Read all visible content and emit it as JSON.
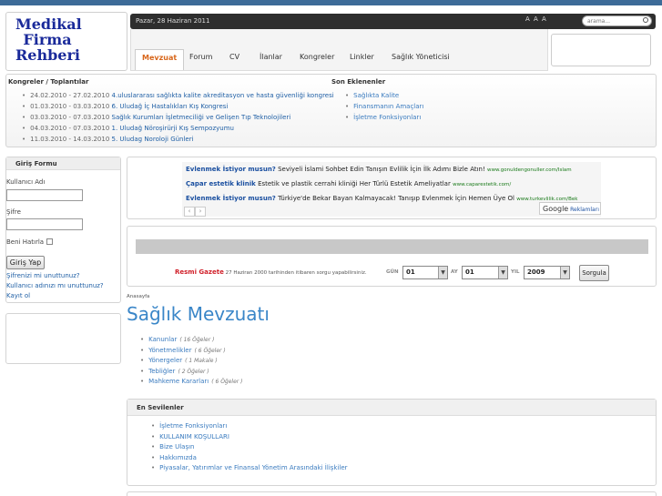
{
  "logo": {
    "line1": "Medikal",
    "line2": "Firma",
    "line3": "Rehberi"
  },
  "header": {
    "date": "Pazar, 28 Haziran 2011",
    "font_sizer": "A A A",
    "search_placeholder": "arama..."
  },
  "nav": {
    "items": [
      "Mevzuat",
      "Forum",
      "CV",
      "İlanlar",
      "Kongreler",
      "Linkler",
      "Sağlık Yöneticisi"
    ],
    "active": "Mevzuat"
  },
  "kongreler": {
    "title": "Kongreler / Toplantılar",
    "items": [
      {
        "dates": "24.02.2010 - 27.02.2010",
        "title": "4.uluslararası sağlıkta kalite akreditasyon ve hasta güvenliği kongresi"
      },
      {
        "dates": "01.03.2010 - 03.03.2010",
        "title": "6. Uludağ İç Hastalıkları Kış Kongresi"
      },
      {
        "dates": "03.03.2010 - 07.03.2010",
        "title": "Sağlık Kurumları İşletmeciliği ve Gelişen Tıp Teknolojileri"
      },
      {
        "dates": "04.03.2010 - 07.03.2010",
        "title": "1. Uludağ Nöroşirürji Kış Sempozyumu"
      },
      {
        "dates": "11.03.2010 - 14.03.2010",
        "title": "5. Uludag Noroloji Günleri"
      }
    ]
  },
  "son_eklenenler": {
    "title": "Son Eklenenler",
    "items": [
      "Sağlıkta Kalite",
      "Finansmanın Amaçları",
      "İşletme Fonksiyonları"
    ]
  },
  "login": {
    "title": "Giriş Formu",
    "username_label": "Kullanıcı Adı",
    "password_label": "Şifre",
    "remember_label": "Beni Hatırla",
    "button": "Giriş Yap",
    "forgot_password": "Şifrenizi mi unuttunuz?",
    "forgot_username": "Kullanıcı adınızı mı unuttunuz?",
    "register": "Kayıt ol"
  },
  "ads": {
    "rows": [
      {
        "title": "Evlenmek İstiyor musun?",
        "text": "Seviyeli İslami Sohbet Edin Tanışın Evlilik İçin İlk Adımı Bizle Atın!",
        "url": "www.gonuldengonuller.com/Islam"
      },
      {
        "title": "Çapar estetik klinik",
        "text": "Estetik ve plastik cerrahi kliniği Her Türlü Estetik Ameliyatlar",
        "url": "www.caparestetik.com/"
      },
      {
        "title": "Evlenmek İstiyor musun?",
        "text": "Türkiye'de Bekar Bayan Kalmayacak! Tanışıp Evlenmek İçin Hemen Üye Ol",
        "url": "www.turkevlilik.com/Bek"
      }
    ],
    "prev": "‹",
    "next": "›",
    "google_label": "Google",
    "reklam_label": "Reklamları"
  },
  "resmi_gazete": {
    "brand": "Resmi Gazete",
    "text": "27 Haziran 2000 tarihinden itibaren sorgu yapabilirsiniz.",
    "gun_label": "GÜN",
    "ay_label": "AY",
    "yil_label": "YIL",
    "gun_value": "01",
    "ay_value": "01",
    "yil_value": "2009",
    "button": "Sorgula"
  },
  "breadcrumb": "Anasayfa",
  "page_title": "Sağlık Mevzuatı",
  "mevzuat": [
    {
      "label": "Kanunlar",
      "count": "( 16 Öğeler )"
    },
    {
      "label": "Yönetmelikler",
      "count": "( 6 Öğeler )"
    },
    {
      "label": "Yönergeler",
      "count": "( 1 Makale )"
    },
    {
      "label": "Tebliğler",
      "count": "( 2 Öğeler )"
    },
    {
      "label": "Mahkeme Kararları",
      "count": "( 6 Öğeler )"
    }
  ],
  "en_sevilenler": {
    "title": "En Sevilenler",
    "items": [
      "İşletme Fonksiyonları",
      "KULLANIM KOŞULLARI",
      "Bize Ulaşın",
      "Hakkımızda",
      "Piyasalar, Yatırımlar ve Finansal Yönetim Arasındaki İlişkiler"
    ]
  }
}
